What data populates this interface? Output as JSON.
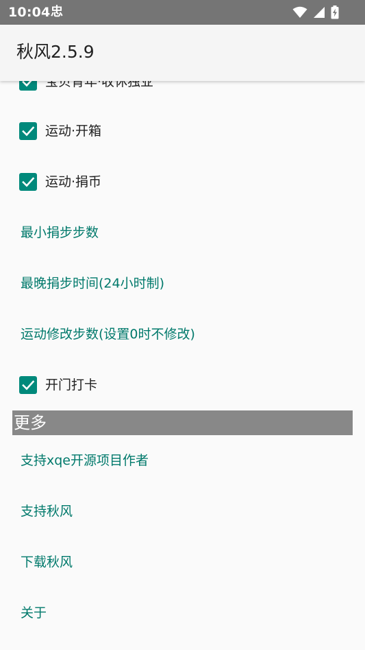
{
  "status_bar": {
    "time": "10:04",
    "notification_glyph": "忠"
  },
  "app_bar": {
    "title": "秋风2.5.9"
  },
  "items_top": [
    {
      "type": "checkbox",
      "label": "宝贝青年·收休独业",
      "checked": true
    },
    {
      "type": "checkbox",
      "label": "运动·开箱",
      "checked": true
    },
    {
      "type": "checkbox",
      "label": "运动·捐币",
      "checked": true
    },
    {
      "type": "link",
      "label": "最小捐步步数"
    },
    {
      "type": "link",
      "label": "最晚捐步时间(24小时制)"
    },
    {
      "type": "link",
      "label": "运动修改步数(设置0时不修改)"
    },
    {
      "type": "checkbox",
      "label": "开门打卡",
      "checked": true
    }
  ],
  "section_more": {
    "title": "更多"
  },
  "items_more": [
    {
      "type": "link",
      "label": "支持xqe开源项目作者"
    },
    {
      "type": "link",
      "label": "支持秋风"
    },
    {
      "type": "link",
      "label": "下载秋风"
    },
    {
      "type": "link",
      "label": "关于"
    }
  ],
  "colors": {
    "accent": "#00897b",
    "link": "#00796b",
    "status_bar": "#757575",
    "section_header": "#888888"
  }
}
